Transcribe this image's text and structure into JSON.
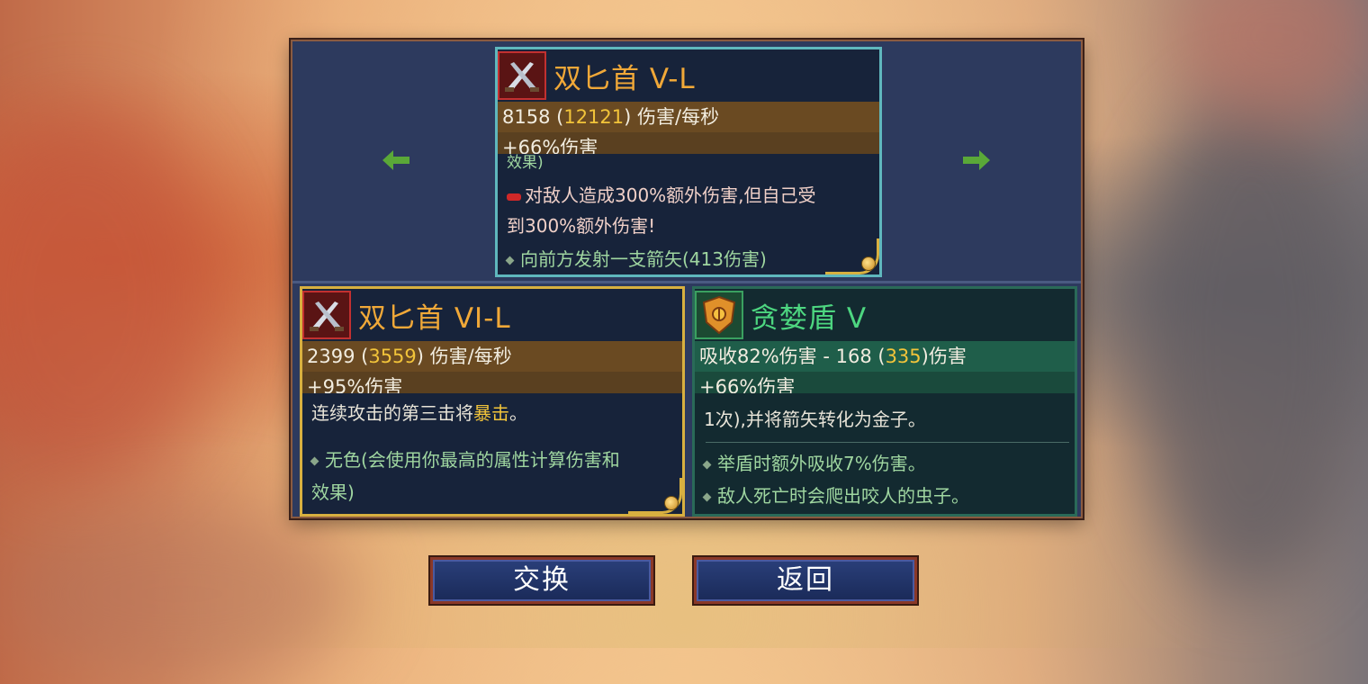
{
  "top_card": {
    "name": "双匕首 V-L",
    "dps_value": "8158",
    "dps_crit": "12121",
    "dps_unit": "伤害/每秒",
    "bonus": "+66%伤害",
    "cutoff_text": "效果)",
    "curse_text_1": "对敌人造成300%额外伤害,但自己受",
    "curse_text_2": "到300%额外伤害!",
    "effect": "向前方发射一支箭矢(413伤害)"
  },
  "left_card": {
    "name": "双匕首 VI-L",
    "dps_value": "2399",
    "dps_crit": "3559",
    "dps_unit": "伤害/每秒",
    "bonus": "+95%伤害",
    "desc_prefix": "连续攻击的第三击将",
    "desc_highlight": "暴击",
    "desc_suffix": "。",
    "effect_1": "无色(会使用你最高的属性计算伤害和",
    "effect_2": "效果)"
  },
  "right_card": {
    "name": "贪婪盾 V",
    "absorb_prefix": "吸收82%伤害 - 168 (",
    "absorb_crit": "335",
    "absorb_suffix": ")伤害",
    "bonus": "+66%伤害",
    "desc": "1次),并将箭矢转化为金子。",
    "effect_1": "举盾时额外吸收7%伤害。",
    "effect_2": "敌人死亡时会爬出咬人的虫子。"
  },
  "buttons": {
    "swap": "交换",
    "back": "返回"
  },
  "colors": {
    "name_orange": "#f0a838",
    "name_green": "#4dd680",
    "highlight": "#f2c43a",
    "arrow_green": "#5aa838"
  }
}
